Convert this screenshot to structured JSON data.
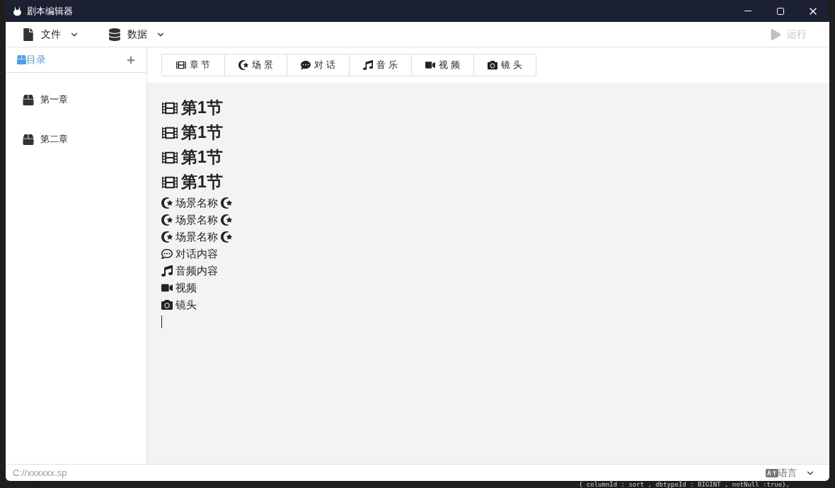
{
  "window": {
    "title": "剧本编辑器"
  },
  "menu": [
    {
      "label": "文件",
      "kind": "file"
    },
    {
      "label": "数据",
      "kind": "data"
    }
  ],
  "run_button": {
    "label": "运行",
    "disabled": true
  },
  "sidebar": {
    "title": "目录",
    "items": [
      {
        "label": "第一章"
      },
      {
        "label": "第二章"
      }
    ]
  },
  "toolbar": [
    {
      "label": "章 节",
      "kind": "chapter"
    },
    {
      "label": "场 景",
      "kind": "scene"
    },
    {
      "label": "对 话",
      "kind": "dialogue"
    },
    {
      "label": "音 乐",
      "kind": "music"
    },
    {
      "label": "视 频",
      "kind": "video"
    },
    {
      "label": "镜 头",
      "kind": "shot"
    }
  ],
  "content": [
    {
      "kind": "chapter",
      "text": "第1节"
    },
    {
      "kind": "chapter",
      "text": "第1节"
    },
    {
      "kind": "chapter",
      "text": "第1节"
    },
    {
      "kind": "chapter",
      "text": "第1节"
    },
    {
      "kind": "scene",
      "text": "场景名称"
    },
    {
      "kind": "scene",
      "text": "场景名称"
    },
    {
      "kind": "scene",
      "text": "场景名称"
    },
    {
      "kind": "dialogue",
      "text": "对话内容"
    },
    {
      "kind": "music",
      "text": "音频内容"
    },
    {
      "kind": "video",
      "text": "视频"
    },
    {
      "kind": "shot",
      "text": "镜头"
    },
    {
      "kind": "cursor"
    }
  ],
  "status_bar": {
    "path": "C://xxxxxx.sp",
    "language": "语言"
  },
  "background_code": "{ columnId : sort , dbtypeId : BIGINT , notNull :true},"
}
